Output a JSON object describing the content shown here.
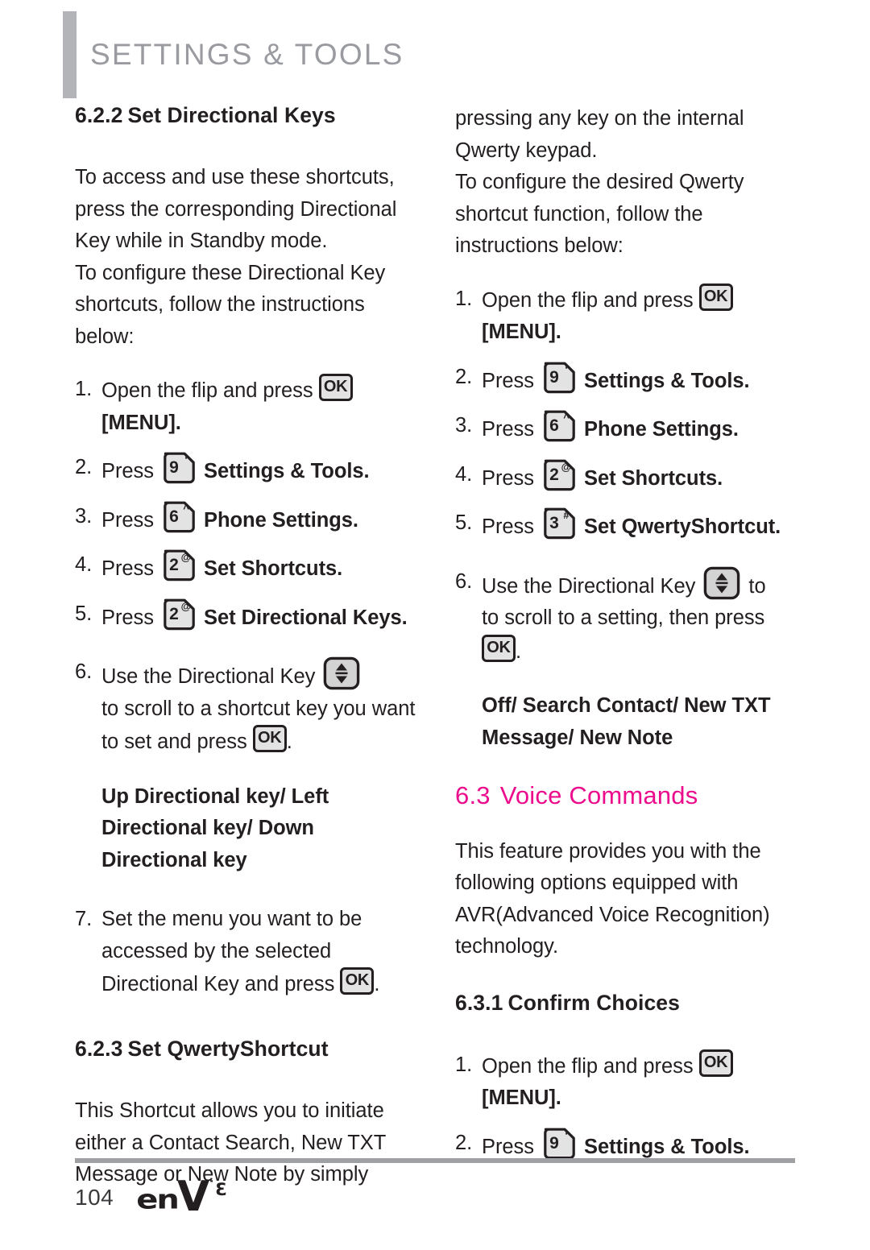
{
  "header": {
    "title": "SETTINGS & TOOLS"
  },
  "left_column": {
    "section_heading": {
      "number": "6.2.2",
      "title": "Set Directional Keys"
    },
    "intro_paragraph_1": "To access and use these shortcuts, press the corresponding Directional Key while in Standby mode.",
    "intro_paragraph_2": "To configure these Directional Key shortcuts, follow the instructions below:",
    "steps": [
      {
        "num": "1.",
        "text_before": "Open the flip and press",
        "icon": "ok-key-icon",
        "text_after": "",
        "bold_after": "[MENU]."
      },
      {
        "num": "2.",
        "text_before": "Press",
        "icon": "keypad-9-key-icon",
        "bold_after": "Settings & Tools."
      },
      {
        "num": "3.",
        "text_before": "Press",
        "icon": "keypad-6-key-icon",
        "bold_after": "Phone Settings."
      },
      {
        "num": "4.",
        "text_before": "Press",
        "icon": "keypad-2-key-icon",
        "bold_after": "Set Shortcuts."
      },
      {
        "num": "5.",
        "text_before": "Press",
        "icon": "keypad-2-key-icon",
        "bold_after": "Set Directional Keys."
      },
      {
        "num": "6.",
        "text_before": "Use the Directional Key",
        "icon": "updown-directional-key-icon",
        "text_after": "to scroll to a shortcut key you want to set and press",
        "icon2": "ok-key-icon",
        "text_end": "."
      },
      {
        "num": "7.",
        "text_before": "Set the menu you want to be accessed by the selected Directional Key and press",
        "icon2": "ok-key-icon",
        "text_end": "."
      }
    ],
    "options_bold": "Up Directional key/ Left Directional key/ Down Directional key",
    "section_heading_2": {
      "number": "6.2.3",
      "title": "Set QwertyShortcut"
    },
    "paragraph_2": "This Shortcut allows you to initiate either a Contact Search, New TXT Message or New Note by simply"
  },
  "right_column": {
    "continued_paragraph_1": "pressing any key on the internal Qwerty keypad.",
    "continued_paragraph_2": "To configure the desired Qwerty shortcut function, follow the instructions below:",
    "steps": [
      {
        "num": "1.",
        "text_before": "Open the flip and press",
        "icon": "ok-key-icon",
        "bold_after": "[MENU]."
      },
      {
        "num": "2.",
        "text_before": "Press",
        "icon": "keypad-9-key-icon",
        "bold_after": "Settings & Tools."
      },
      {
        "num": "3.",
        "text_before": "Press",
        "icon": "keypad-6-key-icon",
        "bold_after": "Phone Settings."
      },
      {
        "num": "4.",
        "text_before": "Press",
        "icon": "keypad-2-key-icon",
        "bold_after": "Set Shortcuts."
      },
      {
        "num": "5.",
        "text_before": "Press",
        "icon": "keypad-3-key-icon",
        "bold_after": "Set QwertyShortcut."
      },
      {
        "num": "6.",
        "text_before": "Use the Directional Key",
        "icon": "updown-directional-key-icon",
        "text_after": "to scroll to a setting, then press",
        "icon2": "ok-key-icon",
        "text_end": "."
      }
    ],
    "options_bold": "Off/ Search Contact/ New TXT Message/ New Note",
    "main_heading": {
      "number": "6.3",
      "title": "Voice Commands"
    },
    "paragraph": "This feature provides you with the following options equipped with AVR(Advanced Voice Recognition) technology.",
    "section_heading": {
      "number": "6.3.1",
      "title": "Confirm Choices"
    },
    "steps_2": [
      {
        "num": "1.",
        "text_before": "Open the flip and press",
        "icon": "ok-key-icon",
        "bold_after": "[MENU]."
      },
      {
        "num": "2.",
        "text_before": "Press",
        "icon": "keypad-9-key-icon",
        "bold_after": "Settings & Tools."
      }
    ]
  },
  "keys": {
    "ok_label": "OK",
    "k9_digit": "9",
    "k9_sup": "‘",
    "k6_digit": "6",
    "k6_sup": "^",
    "k2_digit": "2",
    "k2_sup": "@",
    "k3_digit": "3",
    "k3_sup": "#"
  },
  "footer": {
    "page_number": "104",
    "brand_en": "en",
    "brand_v": "V",
    "brand_dot": "˙",
    "brand_sup": "3"
  },
  "colors": {
    "accent_pink": "#ec0c8c",
    "header_gray": "#9a9ba0",
    "rule_gray": "#9fa0a4",
    "key_fill": "#e3e3e3",
    "text": "#231f20"
  }
}
